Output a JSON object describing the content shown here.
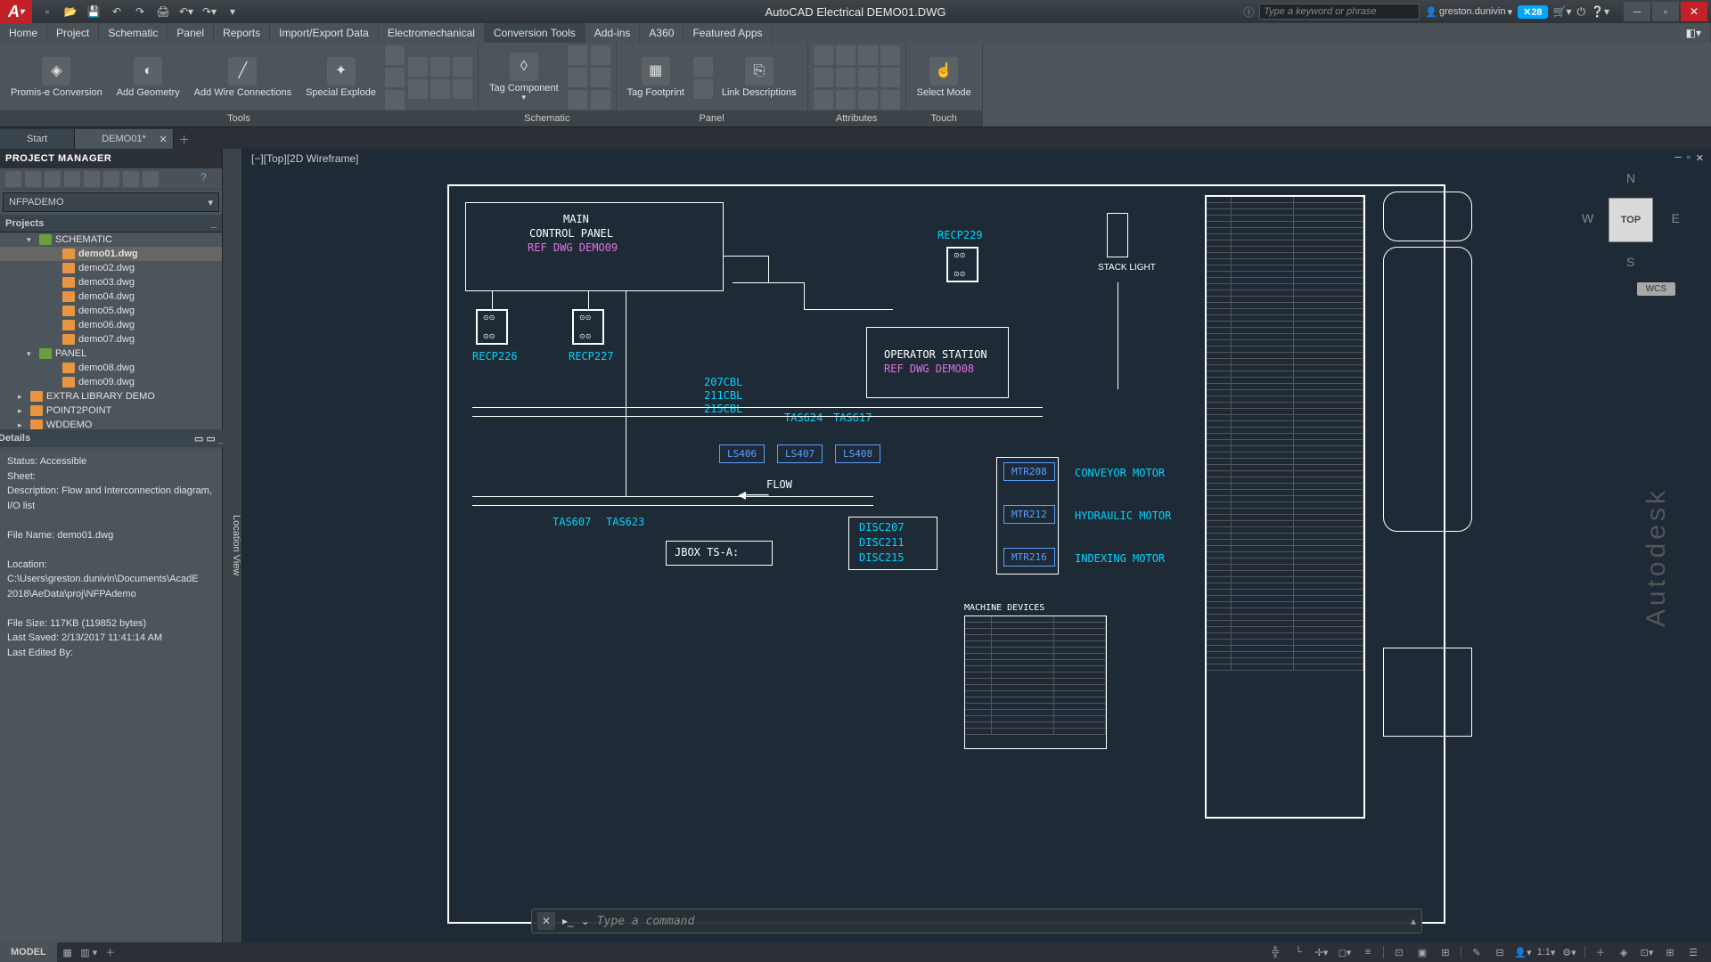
{
  "title": "AutoCAD Electrical   DEMO01.DWG",
  "search_placeholder": "Type a keyword or phrase",
  "user": "greston.dunivin",
  "notif_count": "28",
  "menus": [
    "Home",
    "Project",
    "Schematic",
    "Panel",
    "Reports",
    "Import/Export Data",
    "Electromechanical",
    "Conversion Tools",
    "Add-ins",
    "A360",
    "Featured Apps"
  ],
  "active_menu": "Conversion Tools",
  "ribbon": {
    "panels": [
      {
        "title": "Tools",
        "items": [
          "Promis-e Conversion",
          "Add Geometry",
          "Add Wire Connections",
          "Special Explode"
        ]
      },
      {
        "title": "Schematic",
        "items": [
          "Tag Component"
        ]
      },
      {
        "title": "Panel",
        "items": [
          "Tag Footprint",
          "Link Descriptions"
        ]
      },
      {
        "title": "Attributes",
        "items": []
      },
      {
        "title": "Touch",
        "items": [
          "Select Mode"
        ]
      }
    ]
  },
  "doc_tabs": [
    "Start",
    "DEMO01*"
  ],
  "pm": {
    "header": "PROJECT MANAGER",
    "combo": "NFPADEMO",
    "projects": "Projects",
    "tree": [
      {
        "l": 1,
        "t": "SCHEMATIC",
        "exp": "▾",
        "grn": true
      },
      {
        "l": 2,
        "t": "demo01.dwg",
        "bold": true,
        "hl": true
      },
      {
        "l": 2,
        "t": "demo02.dwg"
      },
      {
        "l": 2,
        "t": "demo03.dwg"
      },
      {
        "l": 2,
        "t": "demo04.dwg"
      },
      {
        "l": 2,
        "t": "demo05.dwg"
      },
      {
        "l": 2,
        "t": "demo06.dwg"
      },
      {
        "l": 2,
        "t": "demo07.dwg"
      },
      {
        "l": 1,
        "t": "PANEL",
        "exp": "▾",
        "grn": true
      },
      {
        "l": 2,
        "t": "demo08.dwg"
      },
      {
        "l": 2,
        "t": "demo09.dwg"
      },
      {
        "l": 0,
        "t": "EXTRA LIBRARY DEMO",
        "exp": "▸"
      },
      {
        "l": 0,
        "t": "POINT2POINT",
        "exp": "▸"
      },
      {
        "l": 0,
        "t": "WDDEMO",
        "exp": "▸"
      }
    ],
    "details_hdr": "Details",
    "details": {
      "status": "Status: Accessible",
      "sheet": "Sheet:",
      "desc": "Description: Flow and Interconnection diagram, I/O list",
      "fname": "File Name: demo01.dwg",
      "loc": "Location: C:\\Users\\greston.dunivin\\Documents\\AcadE 2018\\AeData\\proj\\NFPAdemo",
      "size": "File Size: 117KB (119852 bytes)",
      "saved": "Last Saved: 2/13/2017 11:41:14 AM",
      "edited": "Last Edited By:"
    }
  },
  "loc_tab": "Location View",
  "vp_label": "[−][Top][2D Wireframe]",
  "wcs": "WCS",
  "viewcube": "TOP",
  "dwg": {
    "main_panel": {
      "l1": "MAIN",
      "l2": "CONTROL  PANEL",
      "l3": "REF  DWG  DEMO09"
    },
    "op_station": {
      "l1": "OPERATOR  STATION",
      "l2": "REF  DWG  DEMO08"
    },
    "recp": [
      "RECP226",
      "RECP227",
      "RECP229"
    ],
    "stack": "STACK LIGHT",
    "cbl": [
      "207CBL",
      "211CBL",
      "215CBL"
    ],
    "tas": [
      "TAS624",
      "TAS617"
    ],
    "ls": [
      "LS406",
      "LS407",
      "LS408"
    ],
    "tas2": [
      "TAS607",
      "TAS623"
    ],
    "jbox": "JBOX  TS-A:",
    "flow": "FLOW",
    "disc": [
      "DISC207",
      "DISC211",
      "DISC215"
    ],
    "mtr": [
      {
        "id": "MTR208",
        "desc": "CONVEYOR  MOTOR"
      },
      {
        "id": "MTR212",
        "desc": "HYDRAULIC  MOTOR"
      },
      {
        "id": "MTR216",
        "desc": "INDEXING  MOTOR"
      }
    ],
    "mach_hdr": "MACHINE  DEVICES"
  },
  "cmd_placeholder": "Type a command",
  "sb_model": "MODEL",
  "sb_ratio": "1:1"
}
